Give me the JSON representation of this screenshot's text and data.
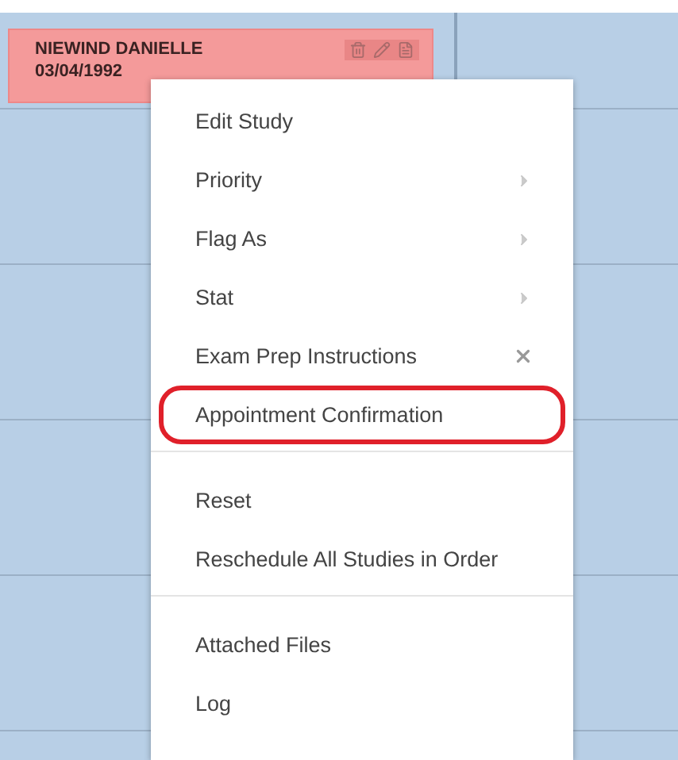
{
  "appointment": {
    "patient": "NIEWIND DANIELLE",
    "date": "03/04/1992"
  },
  "context_menu": {
    "groups": [
      [
        {
          "label": "Edit Study",
          "kind": "plain",
          "highlighted": false
        },
        {
          "label": "Priority",
          "kind": "submenu",
          "highlighted": false
        },
        {
          "label": "Flag As",
          "kind": "submenu",
          "highlighted": false
        },
        {
          "label": "Stat",
          "kind": "submenu",
          "highlighted": false
        },
        {
          "label": "Exam Prep Instructions",
          "kind": "removable",
          "highlighted": false
        },
        {
          "label": "Appointment Confirmation",
          "kind": "plain",
          "highlighted": true
        }
      ],
      [
        {
          "label": "Reset",
          "kind": "plain",
          "highlighted": false
        },
        {
          "label": "Reschedule All Studies in Order",
          "kind": "plain",
          "highlighted": false
        }
      ],
      [
        {
          "label": "Attached Files",
          "kind": "plain",
          "highlighted": false
        },
        {
          "label": "Log",
          "kind": "plain",
          "highlighted": false
        }
      ]
    ]
  }
}
